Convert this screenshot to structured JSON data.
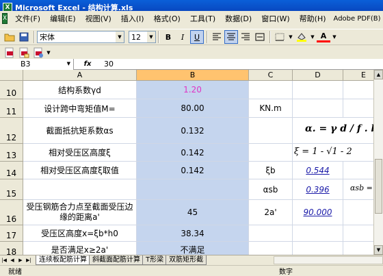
{
  "window": {
    "title": "Microsoft Excel - 结构计算.xls"
  },
  "menu": [
    "文件(F)",
    "编辑(E)",
    "视图(V)",
    "插入(I)",
    "格式(O)",
    "工具(T)",
    "数据(D)",
    "窗口(W)",
    "帮助(H)",
    "Adobe PDF(B)"
  ],
  "toolbar": {
    "font_name": "宋体",
    "font_size": "12",
    "bold": "B",
    "italic": "I",
    "underline": "U",
    "font_color_label": "A"
  },
  "formula_bar": {
    "name_box": "B3",
    "fx": "fx",
    "value": "30"
  },
  "columns": [
    "A",
    "B",
    "C",
    "D",
    "E"
  ],
  "rows": [
    {
      "num": "10",
      "a": "结构系数γd",
      "b": "1.20",
      "c": "",
      "d": ""
    },
    {
      "num": "11",
      "a": "设计跨中弯矩值M=",
      "b": "80.00",
      "c": "KN.m",
      "d": ""
    },
    {
      "num": "12",
      "a": "截面抵抗矩系数αs",
      "b": "0.132",
      "c": "",
      "d": ""
    },
    {
      "num": "13",
      "a": "相对受压区高度ξ",
      "b": "0.142",
      "c": "",
      "d": ""
    },
    {
      "num": "14",
      "a": "相对受压区高度ξ取值",
      "b": "0.142",
      "c": "ξb",
      "d": "0.544"
    },
    {
      "num": "15",
      "a": "",
      "b": "",
      "c": "αsb",
      "d": "0.396"
    },
    {
      "num": "16",
      "a": "受压钢筋合力点至截面受压边缘的距离a'",
      "b": "45",
      "c": "2a'",
      "d": "90.000"
    },
    {
      "num": "17",
      "a": "受压区高度x=ξb*h0",
      "b": "38.34",
      "c": "",
      "d": ""
    },
    {
      "num": "18",
      "a": "是否满足x≥2a'",
      "b": "不满足",
      "c": "",
      "d": ""
    }
  ],
  "formulas": {
    "e12": "α. = γ d / f . bh",
    "e13": "ξ = 1 - √1 - 2",
    "e15": "αsb ="
  },
  "tabs": [
    "连续板配筋计算",
    "斜截面配筋计算",
    "T形梁",
    "双筋矩形截"
  ],
  "status": {
    "left": "就绪",
    "right": "数字"
  }
}
